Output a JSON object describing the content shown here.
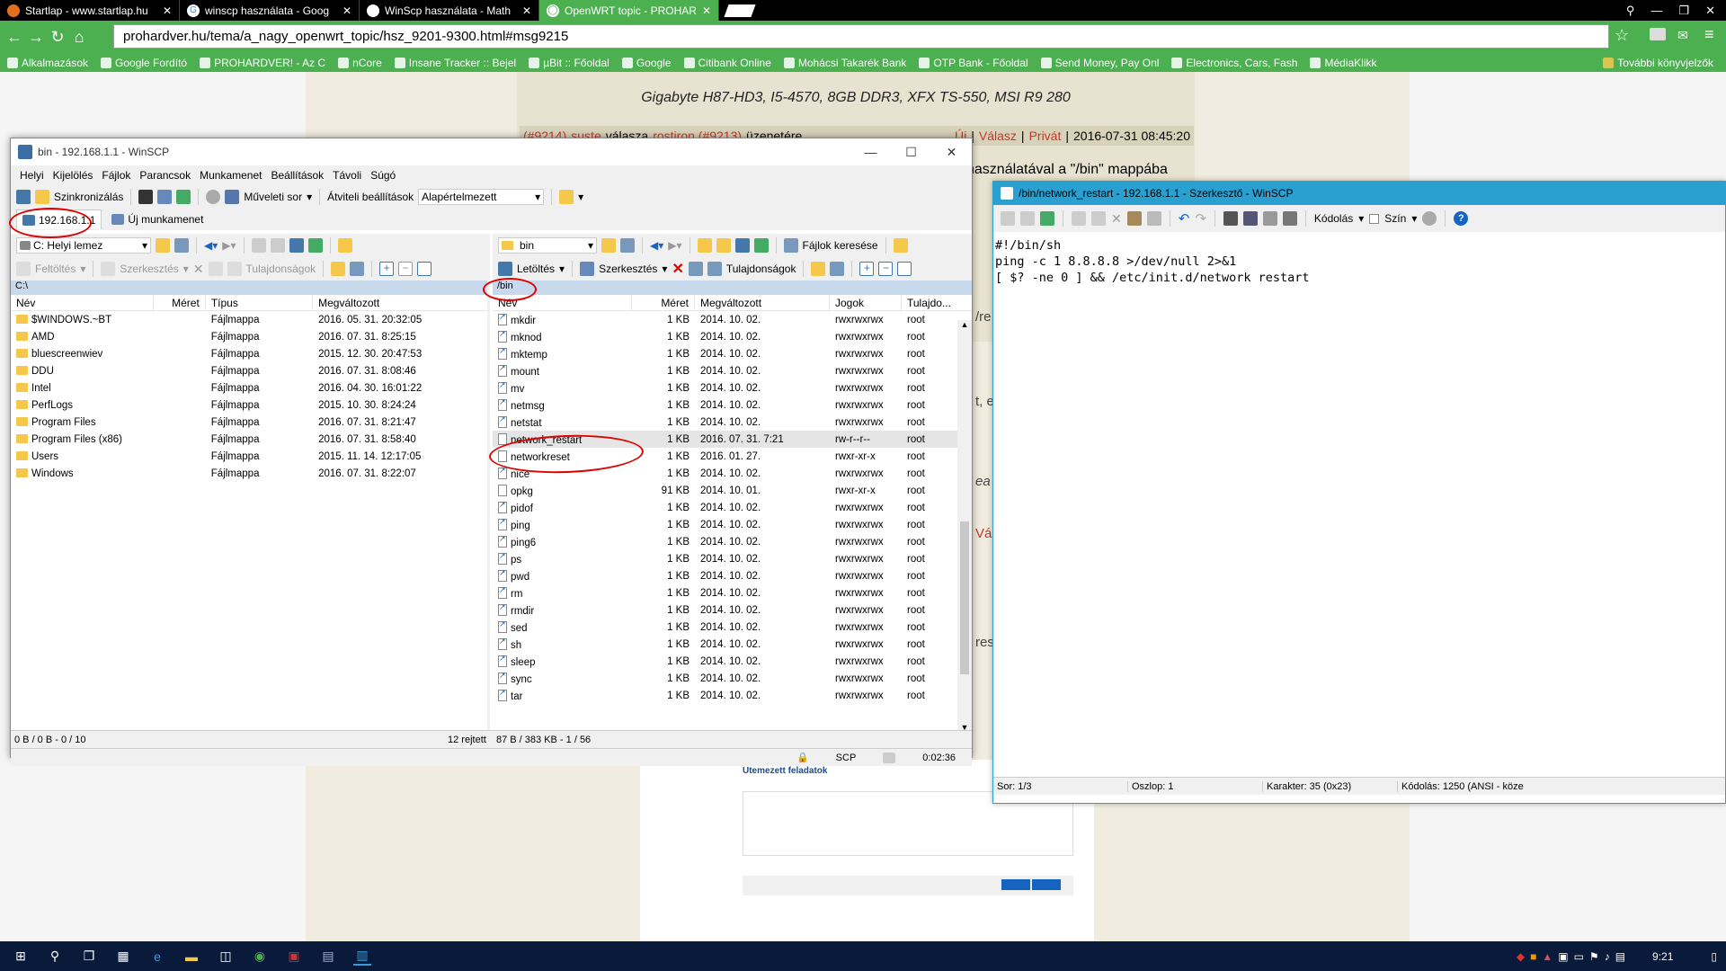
{
  "browser": {
    "tabs": [
      {
        "label": "Startlap - www.startlap.hu",
        "icon": "startlap-icon",
        "active": false
      },
      {
        "label": "winscp használata - Goog",
        "icon": "google-icon",
        "active": false
      },
      {
        "label": "WinScp használata - Math",
        "icon": "page-icon",
        "active": false
      },
      {
        "label": "OpenWRT topic - PROHAR",
        "icon": "prohardver-icon",
        "active": true
      }
    ],
    "url": "prohardver.hu/tema/a_nagy_openwrt_topic/hsz_9201-9300.html#msg9215",
    "bookmarks": [
      "Alkalmazások",
      "Google Fordító",
      "PROHARDVER! - Az C",
      "nCore",
      "Insane Tracker :: Bejel",
      "µBit :: Főoldal",
      "Google",
      "Citibank Online",
      "Mohácsi Takarék Bank",
      "OTP Bank - Főoldal",
      "Send Money, Pay Onl",
      "Electronics, Cars, Fash",
      "MédiaKlikk"
    ],
    "other_bookmarks": "További könyvjelzők"
  },
  "page": {
    "signature": "Gigabyte H87-HD3, I5-4570, 8GB DDR3, XFX TS-550, MSI R9 280",
    "post_ref": "(#9214)",
    "post_author": "suste",
    "post_reply_word": "válasza",
    "post_target": "rostiron (#9213)",
    "post_suffix": "üzenetére",
    "post_new": "Új",
    "post_reply": "Válasz",
    "post_private": "Privát",
    "post_date": "2016-07-31 08:45:20",
    "post_text": "használatával a \"/bin\" mappába",
    "side_fragments": [
      "/re",
      "t, e",
      "ea",
      "Vál",
      "res"
    ],
    "scheduled_title": "Ütemezett feladatok"
  },
  "winscp": {
    "title": "bin - 192.168.1.1 - WinSCP",
    "menu": [
      "Helyi",
      "Kijelölés",
      "Fájlok",
      "Parancsok",
      "Munkamenet",
      "Beállítások",
      "Távoli",
      "Súgó"
    ],
    "toolbar": {
      "sync": "Szinkronizálás",
      "queue": "Műveleti sor",
      "transfer_settings": "Átviteli beállítások",
      "transfer_preset": "Alapértelmezett"
    },
    "sessions": {
      "active": "192.168.1.1",
      "new": "Új munkamenet"
    },
    "left": {
      "drive": "C: Helyi lemez",
      "actions": [
        "Feltöltés",
        "Szerkesztés",
        "Tulajdonságok"
      ],
      "path": "C:\\",
      "columns": [
        "Név",
        "Méret",
        "Típus",
        "Megváltozott"
      ],
      "rows": [
        [
          "$WINDOWS.~BT",
          "",
          "Fájlmappa",
          "2016. 05. 31.  20:32:05"
        ],
        [
          "AMD",
          "",
          "Fájlmappa",
          "2016. 07. 31.  8:25:15"
        ],
        [
          "bluescreenwiev",
          "",
          "Fájlmappa",
          "2015. 12. 30.  20:47:53"
        ],
        [
          "DDU",
          "",
          "Fájlmappa",
          "2016. 07. 31.  8:08:46"
        ],
        [
          "Intel",
          "",
          "Fájlmappa",
          "2016. 04. 30.  16:01:22"
        ],
        [
          "PerfLogs",
          "",
          "Fájlmappa",
          "2015. 10. 30.  8:24:24"
        ],
        [
          "Program Files",
          "",
          "Fájlmappa",
          "2016. 07. 31.  8:21:47"
        ],
        [
          "Program Files (x86)",
          "",
          "Fájlmappa",
          "2016. 07. 31.  8:58:40"
        ],
        [
          "Users",
          "",
          "Fájlmappa",
          "2015. 11. 14.  12:17:05"
        ],
        [
          "Windows",
          "",
          "Fájlmappa",
          "2016. 07. 31.  8:22:07"
        ]
      ],
      "status": "0 B / 0 B - 0 / 10",
      "hidden": "12 rejtett"
    },
    "right": {
      "dir": "bin",
      "find": "Fájlok keresése",
      "actions": [
        "Letöltés",
        "Szerkesztés",
        "Tulajdonságok"
      ],
      "path": "/bin",
      "columns": [
        "Név",
        "Méret",
        "Megváltozott",
        "Jogok",
        "Tulajdo..."
      ],
      "rows": [
        [
          "mkdir",
          "1 KB",
          "2014. 10. 02.",
          "rwxrwxrwx",
          "root",
          "link"
        ],
        [
          "mknod",
          "1 KB",
          "2014. 10. 02.",
          "rwxrwxrwx",
          "root",
          "link"
        ],
        [
          "mktemp",
          "1 KB",
          "2014. 10. 02.",
          "rwxrwxrwx",
          "root",
          "link"
        ],
        [
          "mount",
          "1 KB",
          "2014. 10. 02.",
          "rwxrwxrwx",
          "root",
          "link"
        ],
        [
          "mv",
          "1 KB",
          "2014. 10. 02.",
          "rwxrwxrwx",
          "root",
          "link"
        ],
        [
          "netmsg",
          "1 KB",
          "2014. 10. 02.",
          "rwxrwxrwx",
          "root",
          "link"
        ],
        [
          "netstat",
          "1 KB",
          "2014. 10. 02.",
          "rwxrwxrwx",
          "root",
          "link"
        ],
        [
          "network_restart",
          "1 KB",
          "2016. 07. 31. 7:21",
          "rw-r--r--",
          "root",
          "file"
        ],
        [
          "networkreset",
          "1 KB",
          "2016. 01. 27.",
          "rwxr-xr-x",
          "root",
          "file"
        ],
        [
          "nice",
          "1 KB",
          "2014. 10. 02.",
          "rwxrwxrwx",
          "root",
          "link"
        ],
        [
          "opkg",
          "91 KB",
          "2014. 10. 01.",
          "rwxr-xr-x",
          "root",
          "file"
        ],
        [
          "pidof",
          "1 KB",
          "2014. 10. 02.",
          "rwxrwxrwx",
          "root",
          "link"
        ],
        [
          "ping",
          "1 KB",
          "2014. 10. 02.",
          "rwxrwxrwx",
          "root",
          "link"
        ],
        [
          "ping6",
          "1 KB",
          "2014. 10. 02.",
          "rwxrwxrwx",
          "root",
          "link"
        ],
        [
          "ps",
          "1 KB",
          "2014. 10. 02.",
          "rwxrwxrwx",
          "root",
          "link"
        ],
        [
          "pwd",
          "1 KB",
          "2014. 10. 02.",
          "rwxrwxrwx",
          "root",
          "link"
        ],
        [
          "rm",
          "1 KB",
          "2014. 10. 02.",
          "rwxrwxrwx",
          "root",
          "link"
        ],
        [
          "rmdir",
          "1 KB",
          "2014. 10. 02.",
          "rwxrwxrwx",
          "root",
          "link"
        ],
        [
          "sed",
          "1 KB",
          "2014. 10. 02.",
          "rwxrwxrwx",
          "root",
          "link"
        ],
        [
          "sh",
          "1 KB",
          "2014. 10. 02.",
          "rwxrwxrwx",
          "root",
          "link"
        ],
        [
          "sleep",
          "1 KB",
          "2014. 10. 02.",
          "rwxrwxrwx",
          "root",
          "link"
        ],
        [
          "sync",
          "1 KB",
          "2014. 10. 02.",
          "rwxrwxrwx",
          "root",
          "link"
        ],
        [
          "tar",
          "1 KB",
          "2014. 10. 02.",
          "rwxrwxrwx",
          "root",
          "link"
        ]
      ],
      "status": "87 B / 383 KB - 1 / 56",
      "protocol": "SCP",
      "elapsed": "0:02:36"
    }
  },
  "editor": {
    "title": "/bin/network_restart - 192.168.1.1 - Szerkesztő - WinSCP",
    "encoding_label": "Kódolás",
    "color_label": "Szín",
    "content": "#!/bin/sh\nping -c 1 8.8.8.8 >/dev/null 2>&1\n[ $? -ne 0 ] && /etc/init.d/network restart",
    "status": {
      "line": "Sor: 1/3",
      "column": "Oszlop: 1",
      "char": "Karakter: 35 (0x23)",
      "encoding": "Kódolás: 1250  (ANSI - köze"
    }
  },
  "taskbar": {
    "clock": "9:21"
  }
}
